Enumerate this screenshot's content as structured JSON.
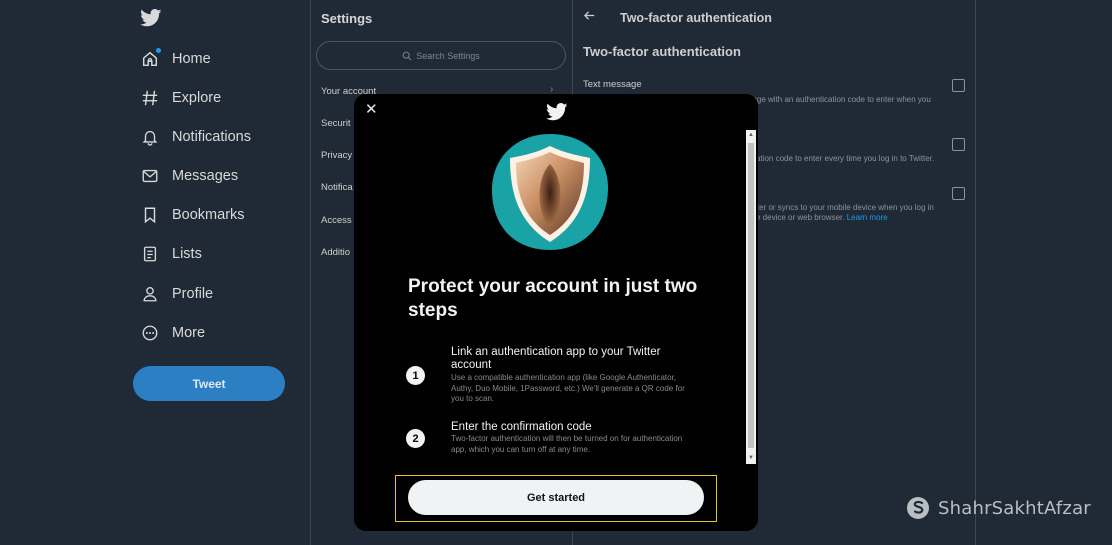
{
  "nav": {
    "items": [
      {
        "label": "Home",
        "icon": "home-icon"
      },
      {
        "label": "Explore",
        "icon": "hashtag-icon"
      },
      {
        "label": "Notifications",
        "icon": "bell-icon"
      },
      {
        "label": "Messages",
        "icon": "mail-icon"
      },
      {
        "label": "Bookmarks",
        "icon": "bookmark-icon"
      },
      {
        "label": "Lists",
        "icon": "list-icon"
      },
      {
        "label": "Profile",
        "icon": "person-icon"
      },
      {
        "label": "More",
        "icon": "more-icon"
      }
    ],
    "tweet_label": "Tweet"
  },
  "settings": {
    "title": "Settings",
    "search_placeholder": "Search Settings",
    "items": [
      "Your account",
      "Securit",
      "Privacy",
      "Notifica",
      "Access",
      "Additio"
    ]
  },
  "tfa": {
    "header": "Two-factor authentication",
    "title": "Two-factor authentication",
    "options": [
      {
        "label": "Text message",
        "desc": "nage with an authentication code to enter when you"
      },
      {
        "label": "",
        "desc": "fication code to enter every time you log in to Twitter."
      },
      {
        "label": "",
        "desc_line1": "puter or syncs to your mobile device when you log in",
        "desc_line2": "bile device or web browser.",
        "link": "Learn more"
      }
    ]
  },
  "modal": {
    "heading": "Protect your account in just two steps",
    "steps": [
      {
        "num": "1",
        "title": "Link an authentication app to your Twitter account",
        "desc": "Use a compatible authentication app (like Google Authenticator, Authy, Duo Mobile, 1Password, etc.) We'll generate a QR code for you to scan."
      },
      {
        "num": "2",
        "title": "Enter the confirmation code",
        "desc": "Two-factor authentication will then be turned on for authentication app, which you can turn off at any time."
      }
    ],
    "button_label": "Get started"
  },
  "watermark": {
    "text": "ShahrSakhtAfzar"
  },
  "colors": {
    "accent": "#1d9bf0",
    "background": "#1f2a36",
    "modal": "#000000",
    "highlight": "#e3c230"
  }
}
